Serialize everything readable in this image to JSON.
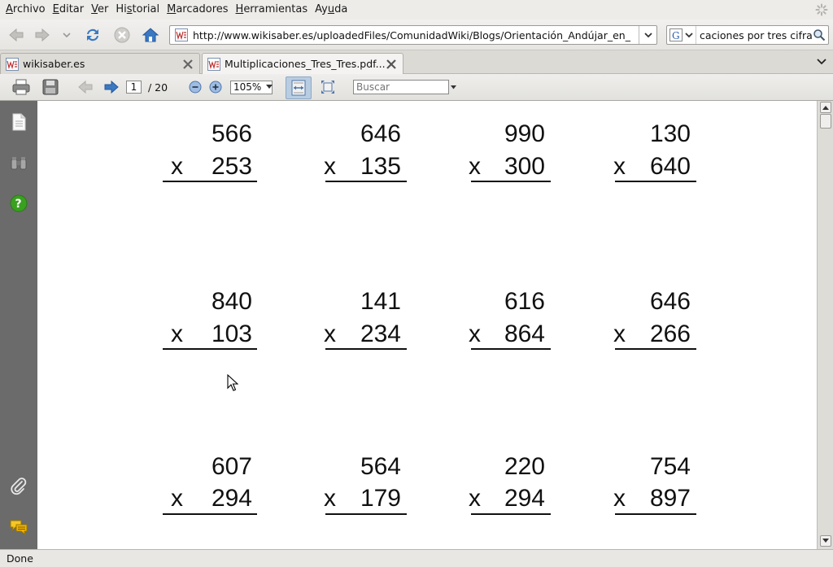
{
  "menu": {
    "items": [
      {
        "first": "A",
        "rest": "rchivo"
      },
      {
        "first": "E",
        "rest": "ditar"
      },
      {
        "first": "V",
        "rest": "er"
      },
      {
        "first": "",
        "rest": "Hi",
        "u": "s",
        "tail": "torial"
      },
      {
        "first": "M",
        "rest": "arcadores"
      },
      {
        "first": "",
        "rest": "",
        "u": "H",
        "tail": "erramientas"
      },
      {
        "first": "",
        "rest": "Ay",
        "u": "u",
        "tail": "da"
      }
    ]
  },
  "nav": {
    "url": "http://www.wikisaber.es/uploadedFiles/ComunidadWiki/Blogs/Orientación_Andújar_en_",
    "search_text": "caciones por tres cifras"
  },
  "tabs": [
    {
      "title": "wikisaber.es",
      "active": false
    },
    {
      "title": "Multiplicaciones_Tres_Tres.pdf...",
      "active": true
    }
  ],
  "pdf_toolbar": {
    "page": "1",
    "page_total": "/  20",
    "zoom": "105%",
    "search_placeholder": "Buscar"
  },
  "problems": [
    {
      "top": "566",
      "bottom": "253",
      "sign": "x"
    },
    {
      "top": "646",
      "bottom": "135",
      "sign": "x"
    },
    {
      "top": "990",
      "bottom": "300",
      "sign": "x"
    },
    {
      "top": "130",
      "bottom": "640",
      "sign": "x"
    },
    {
      "top": "840",
      "bottom": "103",
      "sign": "x"
    },
    {
      "top": "141",
      "bottom": "234",
      "sign": "x"
    },
    {
      "top": "616",
      "bottom": "864",
      "sign": "x"
    },
    {
      "top": "646",
      "bottom": "266",
      "sign": "x"
    },
    {
      "top": "607",
      "bottom": "294",
      "sign": "x"
    },
    {
      "top": "564",
      "bottom": "179",
      "sign": "x"
    },
    {
      "top": "220",
      "bottom": "294",
      "sign": "x"
    },
    {
      "top": "754",
      "bottom": "897",
      "sign": "x"
    }
  ],
  "status": "Done",
  "colors": {
    "sidebar": "#6b6b6b",
    "accent_blue": "#3a78c2",
    "help_green": "#3aa020"
  }
}
